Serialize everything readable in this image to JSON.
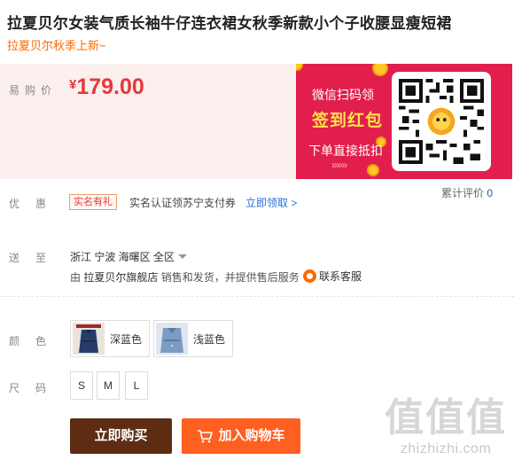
{
  "product": {
    "title": "拉夏贝尔女装气质长袖牛仔连衣裙女秋季新款小个子收腰显瘦短裙",
    "subtitle": "拉夏贝尔秋季上新~"
  },
  "price": {
    "label": "易购价",
    "currency": "¥",
    "amount": "179.00",
    "color": "#e4393c"
  },
  "promo": {
    "line1": "微信扫码领",
    "line2": "签到红包",
    "line3": "下单直接抵扣",
    "arrows": "»»»",
    "bg_color": "#e21f4c"
  },
  "reviews": {
    "label": "累计评价",
    "count": "0"
  },
  "discount": {
    "label": "优惠",
    "badge": "实名有礼",
    "text": "实名认证领苏宁支付券",
    "link": "立即领取 >"
  },
  "delivery": {
    "label": "送至",
    "region": "浙江  宁波  海曙区  全区",
    "ship_prefix": "由",
    "store": "拉夏贝尔旗舰店",
    "ship_suffix": "销售和发货，并提供售后服务",
    "customer_service": "联系客服",
    "cs_icon": "customer-service-icon"
  },
  "options": {
    "color_label": "颜色",
    "colors": [
      {
        "name": "深蓝色",
        "swatch": "#263d6b"
      },
      {
        "name": "浅蓝色",
        "swatch": "#7d9cc3"
      }
    ],
    "size_label": "尺码",
    "sizes": [
      "S",
      "M",
      "L"
    ]
  },
  "actions": {
    "buy_now": "立即购买",
    "add_to_cart": "加入购物车",
    "cart_icon": "cart-icon"
  },
  "watermark": {
    "glyphs": "值值值",
    "site": "zhizhizhi.com"
  }
}
